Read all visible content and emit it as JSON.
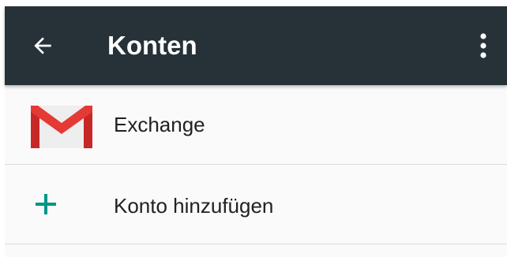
{
  "app_bar": {
    "title": "Konten",
    "back_icon": "arrow-back-icon",
    "overflow_icon": "more-vert-icon",
    "background_color": "#263238"
  },
  "accounts": [
    {
      "label": "Exchange",
      "icon": "gmail-icon"
    }
  ],
  "add_account": {
    "label": "Konto hinzufügen",
    "icon": "plus-icon",
    "icon_color": "#009688"
  }
}
